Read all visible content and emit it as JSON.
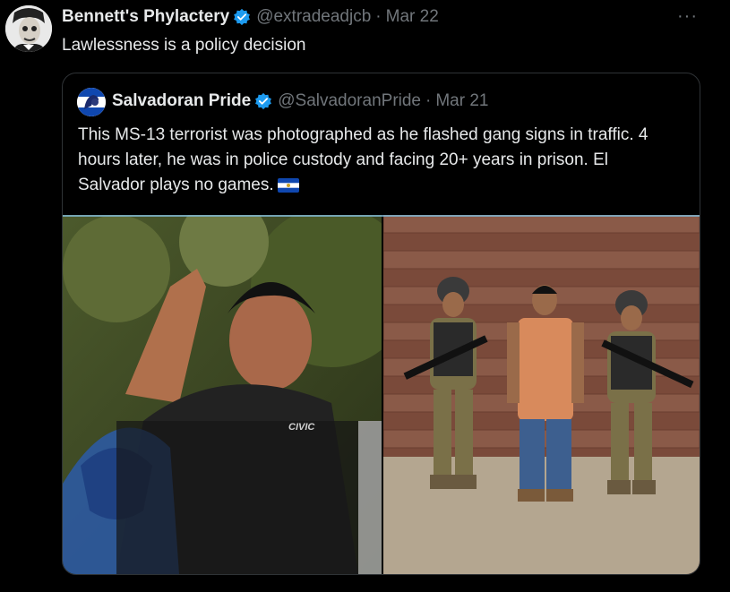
{
  "post": {
    "author_name": "Bennett's Phylactery",
    "handle": "@extradeadjcb",
    "separator": "·",
    "date": "Mar 22",
    "text": "Lawlessness is a policy decision",
    "more_icon": "···"
  },
  "quoted": {
    "author_name": "Salvadoran Pride",
    "handle": "@SalvadoranPride",
    "separator": "·",
    "date": "Mar 21",
    "text": "This MS-13 terrorist was photographed as he flashed gang signs in traffic. 4 hours later, he was in police custody and facing 20+ years in prison. El Salvador plays no games.",
    "flag_icon": "el-salvador-flag-icon",
    "media_left_text": "CIVIC"
  },
  "colors": {
    "background": "#000000",
    "text": "#e7e9ea",
    "muted": "#71767b",
    "verified": "#1d9bf0",
    "border": "#2f3336"
  }
}
